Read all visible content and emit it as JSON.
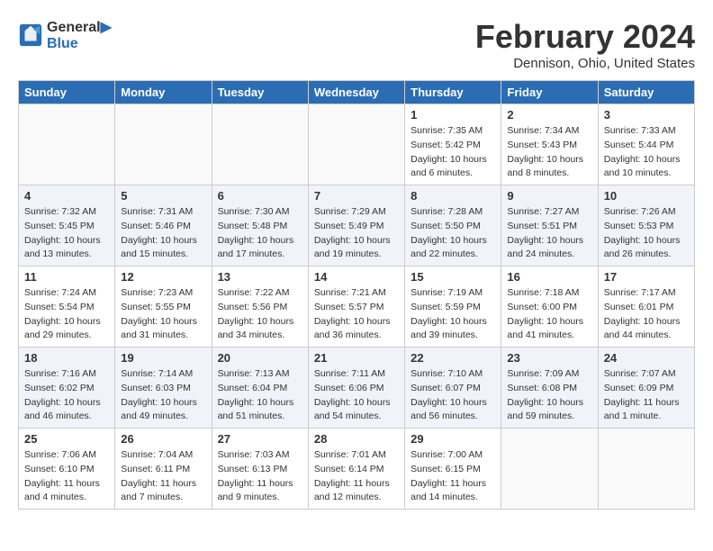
{
  "header": {
    "logo_line1": "General",
    "logo_line2": "Blue",
    "month": "February 2024",
    "location": "Dennison, Ohio, United States"
  },
  "weekdays": [
    "Sunday",
    "Monday",
    "Tuesday",
    "Wednesday",
    "Thursday",
    "Friday",
    "Saturday"
  ],
  "weeks": [
    [
      {
        "day": "",
        "info": ""
      },
      {
        "day": "",
        "info": ""
      },
      {
        "day": "",
        "info": ""
      },
      {
        "day": "",
        "info": ""
      },
      {
        "day": "1",
        "info": "Sunrise: 7:35 AM\nSunset: 5:42 PM\nDaylight: 10 hours\nand 6 minutes."
      },
      {
        "day": "2",
        "info": "Sunrise: 7:34 AM\nSunset: 5:43 PM\nDaylight: 10 hours\nand 8 minutes."
      },
      {
        "day": "3",
        "info": "Sunrise: 7:33 AM\nSunset: 5:44 PM\nDaylight: 10 hours\nand 10 minutes."
      }
    ],
    [
      {
        "day": "4",
        "info": "Sunrise: 7:32 AM\nSunset: 5:45 PM\nDaylight: 10 hours\nand 13 minutes."
      },
      {
        "day": "5",
        "info": "Sunrise: 7:31 AM\nSunset: 5:46 PM\nDaylight: 10 hours\nand 15 minutes."
      },
      {
        "day": "6",
        "info": "Sunrise: 7:30 AM\nSunset: 5:48 PM\nDaylight: 10 hours\nand 17 minutes."
      },
      {
        "day": "7",
        "info": "Sunrise: 7:29 AM\nSunset: 5:49 PM\nDaylight: 10 hours\nand 19 minutes."
      },
      {
        "day": "8",
        "info": "Sunrise: 7:28 AM\nSunset: 5:50 PM\nDaylight: 10 hours\nand 22 minutes."
      },
      {
        "day": "9",
        "info": "Sunrise: 7:27 AM\nSunset: 5:51 PM\nDaylight: 10 hours\nand 24 minutes."
      },
      {
        "day": "10",
        "info": "Sunrise: 7:26 AM\nSunset: 5:53 PM\nDaylight: 10 hours\nand 26 minutes."
      }
    ],
    [
      {
        "day": "11",
        "info": "Sunrise: 7:24 AM\nSunset: 5:54 PM\nDaylight: 10 hours\nand 29 minutes."
      },
      {
        "day": "12",
        "info": "Sunrise: 7:23 AM\nSunset: 5:55 PM\nDaylight: 10 hours\nand 31 minutes."
      },
      {
        "day": "13",
        "info": "Sunrise: 7:22 AM\nSunset: 5:56 PM\nDaylight: 10 hours\nand 34 minutes."
      },
      {
        "day": "14",
        "info": "Sunrise: 7:21 AM\nSunset: 5:57 PM\nDaylight: 10 hours\nand 36 minutes."
      },
      {
        "day": "15",
        "info": "Sunrise: 7:19 AM\nSunset: 5:59 PM\nDaylight: 10 hours\nand 39 minutes."
      },
      {
        "day": "16",
        "info": "Sunrise: 7:18 AM\nSunset: 6:00 PM\nDaylight: 10 hours\nand 41 minutes."
      },
      {
        "day": "17",
        "info": "Sunrise: 7:17 AM\nSunset: 6:01 PM\nDaylight: 10 hours\nand 44 minutes."
      }
    ],
    [
      {
        "day": "18",
        "info": "Sunrise: 7:16 AM\nSunset: 6:02 PM\nDaylight: 10 hours\nand 46 minutes."
      },
      {
        "day": "19",
        "info": "Sunrise: 7:14 AM\nSunset: 6:03 PM\nDaylight: 10 hours\nand 49 minutes."
      },
      {
        "day": "20",
        "info": "Sunrise: 7:13 AM\nSunset: 6:04 PM\nDaylight: 10 hours\nand 51 minutes."
      },
      {
        "day": "21",
        "info": "Sunrise: 7:11 AM\nSunset: 6:06 PM\nDaylight: 10 hours\nand 54 minutes."
      },
      {
        "day": "22",
        "info": "Sunrise: 7:10 AM\nSunset: 6:07 PM\nDaylight: 10 hours\nand 56 minutes."
      },
      {
        "day": "23",
        "info": "Sunrise: 7:09 AM\nSunset: 6:08 PM\nDaylight: 10 hours\nand 59 minutes."
      },
      {
        "day": "24",
        "info": "Sunrise: 7:07 AM\nSunset: 6:09 PM\nDaylight: 11 hours\nand 1 minute."
      }
    ],
    [
      {
        "day": "25",
        "info": "Sunrise: 7:06 AM\nSunset: 6:10 PM\nDaylight: 11 hours\nand 4 minutes."
      },
      {
        "day": "26",
        "info": "Sunrise: 7:04 AM\nSunset: 6:11 PM\nDaylight: 11 hours\nand 7 minutes."
      },
      {
        "day": "27",
        "info": "Sunrise: 7:03 AM\nSunset: 6:13 PM\nDaylight: 11 hours\nand 9 minutes."
      },
      {
        "day": "28",
        "info": "Sunrise: 7:01 AM\nSunset: 6:14 PM\nDaylight: 11 hours\nand 12 minutes."
      },
      {
        "day": "29",
        "info": "Sunrise: 7:00 AM\nSunset: 6:15 PM\nDaylight: 11 hours\nand 14 minutes."
      },
      {
        "day": "",
        "info": ""
      },
      {
        "day": "",
        "info": ""
      }
    ]
  ]
}
